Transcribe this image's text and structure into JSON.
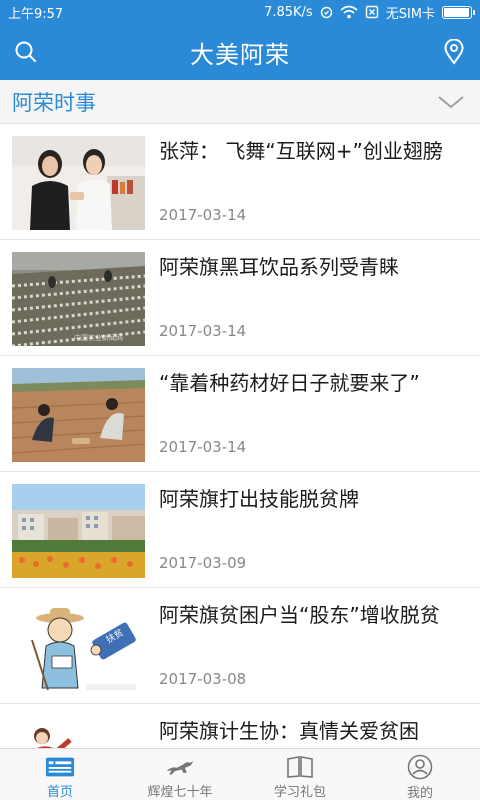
{
  "status_bar": {
    "time": "上午9:57",
    "speed": "7.85K/s",
    "sim": "无SIM卡",
    "battery_level": 0.95
  },
  "header": {
    "title": "大美阿荣",
    "left_icon": "search-icon",
    "right_icon": "location-pin-icon"
  },
  "section": {
    "title": "阿荣时事",
    "toggle_icon": "chevron-down-icon"
  },
  "news": [
    {
      "title": "张萍： 飞舞“互联网+”创业翅膀",
      "date": "2017-03-14"
    },
    {
      "title": "阿荣旗黑耳饮品系列受青睐",
      "date": "2017-03-14",
      "watermark": "中国农业新闻网"
    },
    {
      "title": "“靠着种药材好日子就要来了”",
      "date": "2017-03-14"
    },
    {
      "title": "阿荣旗打出技能脱贫牌",
      "date": "2017-03-09"
    },
    {
      "title": "阿荣旗贫困户当“股东”增收脱贫",
      "date": "2017-03-08",
      "badge": "扶贫"
    },
    {
      "title": "阿荣旗计生协：真情关爱贫困",
      "date": ""
    }
  ],
  "bottom_nav": [
    {
      "label": "首页",
      "icon": "home-icon",
      "active": true
    },
    {
      "label": "辉煌七十年",
      "icon": "horse-icon",
      "active": false
    },
    {
      "label": "学习礼包",
      "icon": "book-icon",
      "active": false
    },
    {
      "label": "我的",
      "icon": "user-icon",
      "active": false
    }
  ],
  "colors": {
    "primary": "#2a8ad8",
    "text": "#1b1b1b",
    "date": "#888888"
  }
}
